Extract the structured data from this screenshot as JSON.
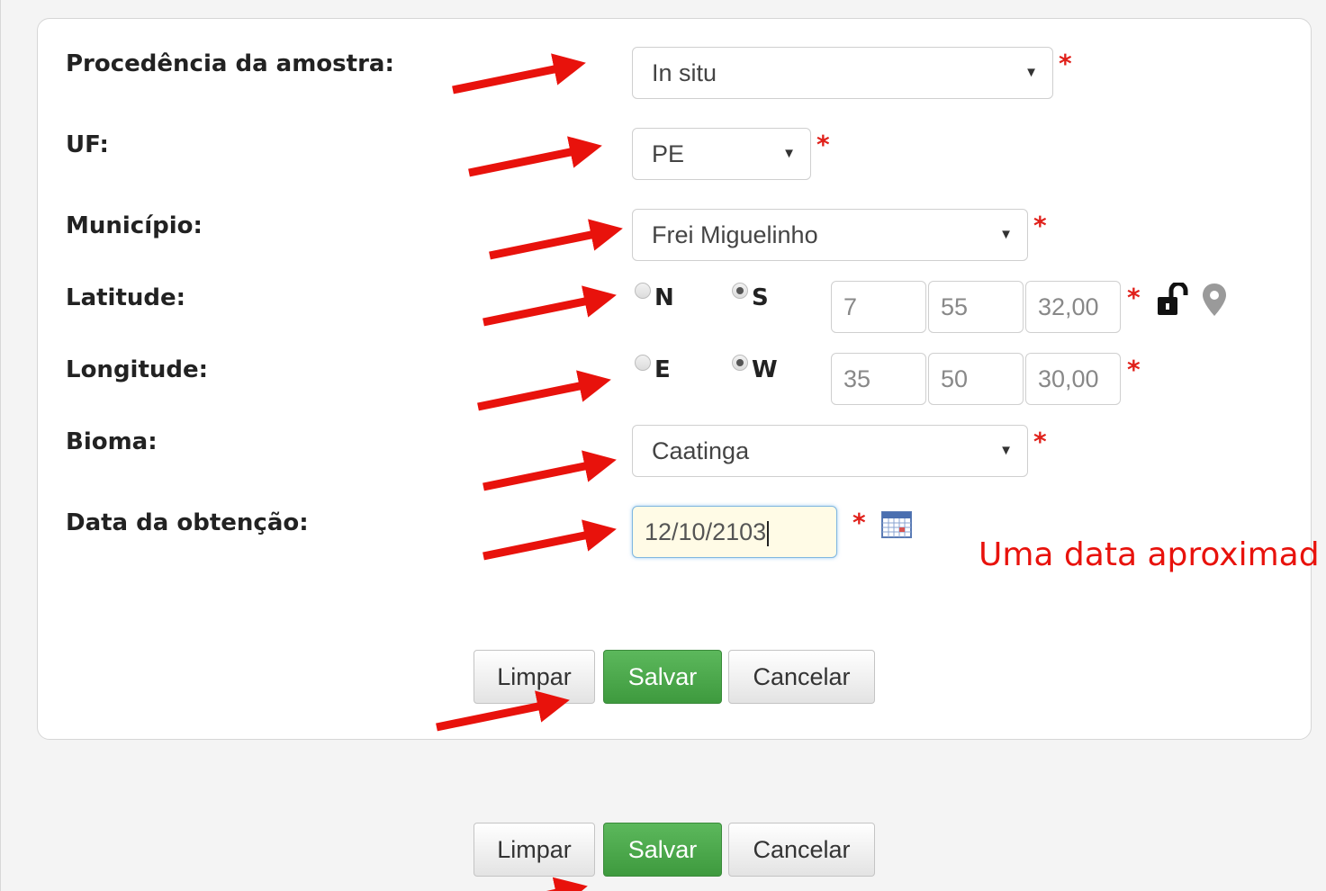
{
  "form": {
    "procedencia": {
      "label": "Procedência da amostra:",
      "value": "In situ",
      "required": "*"
    },
    "uf": {
      "label": "UF:",
      "value": "PE",
      "required": "*"
    },
    "municipio": {
      "label": "Município:",
      "value": "Frei Miguelinho",
      "required": "*"
    },
    "latitude": {
      "label": "Latitude:",
      "options": [
        "N",
        "S"
      ],
      "selected": "S",
      "degrees": "7",
      "minutes": "55",
      "seconds": "32,00",
      "required": "*"
    },
    "longitude": {
      "label": "Longitude:",
      "options": [
        "E",
        "W"
      ],
      "selected": "W",
      "degrees": "35",
      "minutes": "50",
      "seconds": "30,00",
      "required": "*"
    },
    "bioma": {
      "label": "Bioma:",
      "value": "Caatinga",
      "required": "*"
    },
    "data_obtencao": {
      "label": "Data da obtenção:",
      "value": "12/10/2103",
      "required": "*"
    }
  },
  "annotation": {
    "note": "Uma data aproximad"
  },
  "buttons_inner": {
    "clear": "Limpar",
    "save": "Salvar",
    "cancel": "Cancelar"
  },
  "buttons_outer": {
    "clear": "Limpar",
    "save": "Salvar",
    "cancel": "Cancelar"
  },
  "icons": [
    "unlock-icon",
    "map-pin-icon",
    "calendar-icon",
    "dropdown-caret-icon"
  ],
  "colors": {
    "required": "#e0201a",
    "arrow": "#e8120c",
    "save_button": "#4cae4c",
    "focused_input": "#fffbe6"
  }
}
